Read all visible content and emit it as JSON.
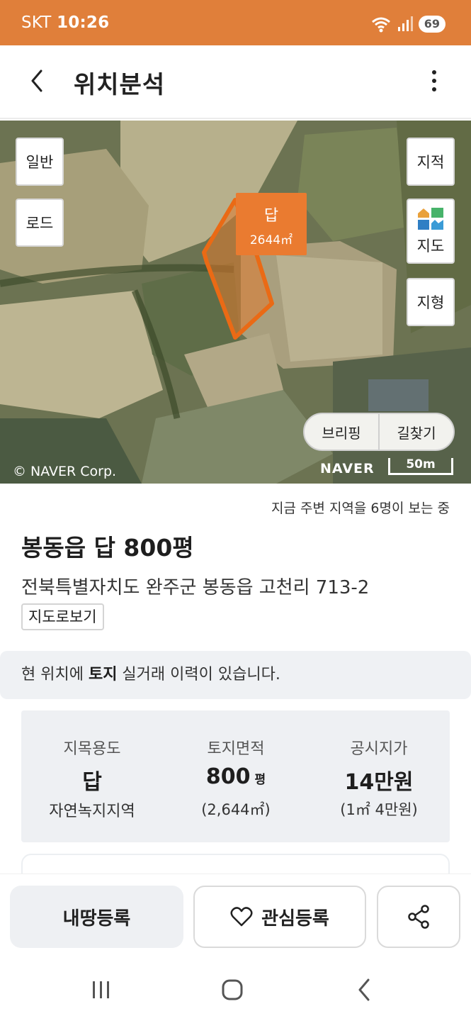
{
  "status_bar": {
    "carrier": "SKT",
    "time": "10:26",
    "battery": "69",
    "icons": [
      "wifi-icon",
      "signal-icon",
      "battery-icon"
    ]
  },
  "header": {
    "title": "위치분석",
    "back_icon": "chevron-left-icon",
    "more_icon": "more-vertical-icon"
  },
  "map": {
    "buttons": {
      "general": "일반",
      "road": "로드",
      "cadastral": "지적",
      "map": "지도",
      "terrain": "지형"
    },
    "parcel": {
      "type": "답",
      "area": "2644㎡"
    },
    "route": {
      "briefing": "브리핑",
      "directions": "길찾기"
    },
    "copyright": "© NAVER Corp.",
    "logo": "NAVER",
    "scale": "50m"
  },
  "viewers": "지금 주변 지역을 6명이 보는 중",
  "listing": {
    "title": "봉동읍 답 800평",
    "address": "전북특별자치도 완주군 봉동읍 고천리 713-2",
    "view_map": "지도로보기"
  },
  "notice": {
    "prefix": "현 위치에 ",
    "highlight": "토지",
    "suffix": " 실거래 이력이 있습니다."
  },
  "info": {
    "land_use": {
      "label": "지목용도",
      "value": "답",
      "sub": "자연녹지지역"
    },
    "area": {
      "label": "토지면적",
      "value": "800",
      "unit": "평",
      "sub": "(2,644㎡)"
    },
    "price": {
      "label": "공시지가",
      "value": "14만원",
      "sub": "(1㎡ 4만원)"
    }
  },
  "actions": {
    "register": "내땅등록",
    "interest": "관심등록",
    "share_icon": "share-icon",
    "heart_icon": "heart-icon"
  },
  "colors": {
    "accent": "#e07f3a",
    "parcel": "#ea7b30"
  }
}
